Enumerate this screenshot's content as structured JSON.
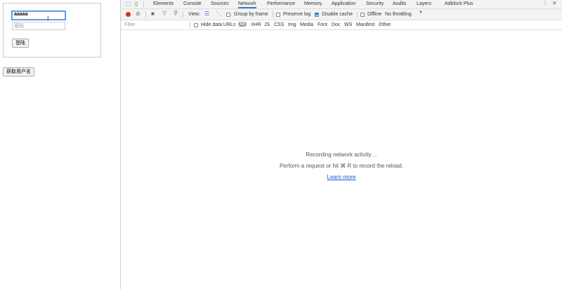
{
  "page": {
    "username_value": "aaaaa",
    "password_placeholder": "密码",
    "login_button": "登陆",
    "get_username_button": "获取用户名"
  },
  "devtools": {
    "tabs": [
      "Elements",
      "Console",
      "Sources",
      "Network",
      "Performance",
      "Memory",
      "Application",
      "Security",
      "Audits",
      "Layers",
      "Adblock Plus"
    ],
    "active_tab": "Network",
    "toolbar": {
      "view_label": "View:",
      "group_by_frame": "Group by frame",
      "preserve_log": "Preserve log",
      "disable_cache": "Disable cache",
      "offline": "Offline",
      "throttling": "No throttling"
    },
    "filter": {
      "placeholder": "Filter",
      "hide_data_urls": "Hide data URLs",
      "types": [
        "All",
        "XHR",
        "JS",
        "CSS",
        "Img",
        "Media",
        "Font",
        "Doc",
        "WS",
        "Manifest",
        "Other"
      ]
    },
    "empty_state": {
      "line1": "Recording network activity…",
      "line2": "Perform a request or hit ⌘ R to record the reload.",
      "link": "Learn more"
    },
    "colors": {
      "record": "#d93025",
      "accent": "#3879d9"
    }
  }
}
